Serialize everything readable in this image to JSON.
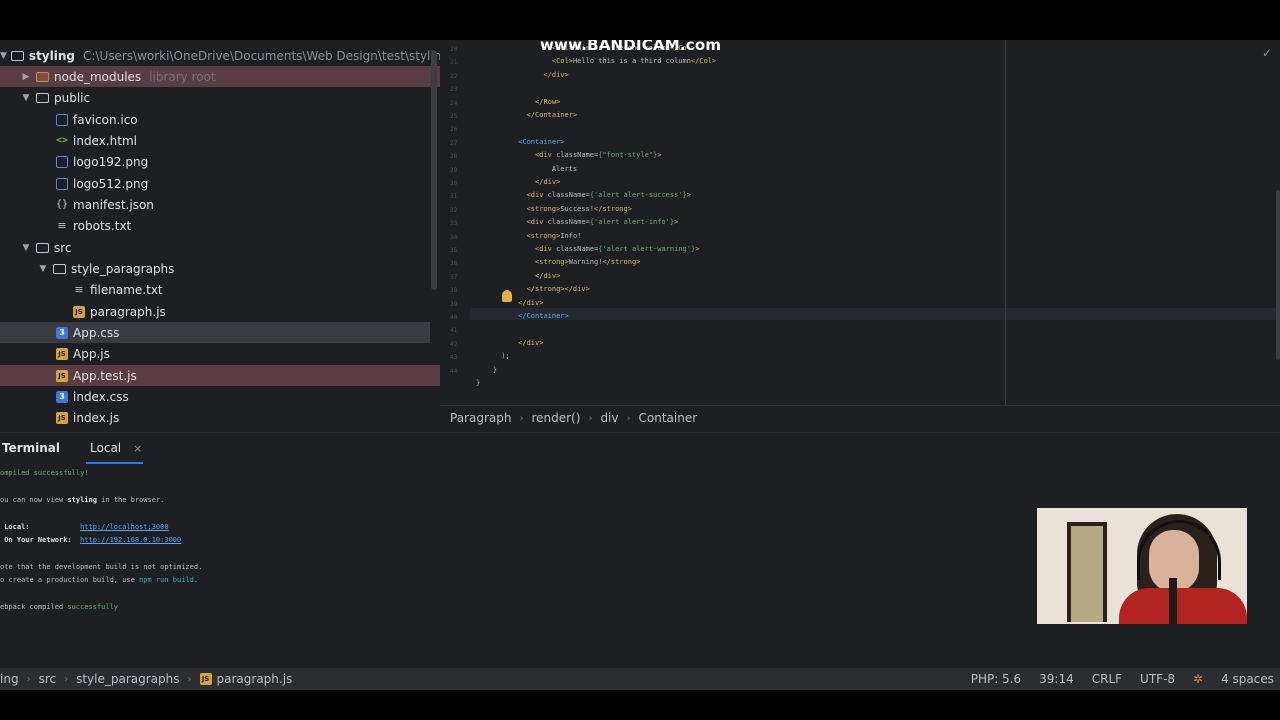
{
  "watermark": "www.BANDICAM.com",
  "project_tree": {
    "root_name": "styling",
    "root_path": "C:\\Users\\worki\\OneDrive\\Documents\\Web Design\\test\\styling",
    "items": [
      {
        "label": "node_modules",
        "note": "library root"
      },
      {
        "label": "public"
      },
      {
        "label": "favicon.ico"
      },
      {
        "label": "index.html"
      },
      {
        "label": "logo192.png"
      },
      {
        "label": "logo512.png"
      },
      {
        "label": "manifest.json"
      },
      {
        "label": "robots.txt"
      },
      {
        "label": "src"
      },
      {
        "label": "style_paragraphs"
      },
      {
        "label": "filename.txt"
      },
      {
        "label": "paragraph.js"
      },
      {
        "label": "App.css"
      },
      {
        "label": "App.js"
      },
      {
        "label": "App.test.js"
      },
      {
        "label": "index.css"
      },
      {
        "label": "index.js"
      }
    ]
  },
  "editor": {
    "line_numbers": [
      "20",
      "21",
      "22",
      "23",
      "24",
      "25",
      "26",
      "27",
      "28",
      "29",
      "30",
      "31",
      "32",
      "33",
      "34",
      "35",
      "36",
      "37",
      "38",
      "39",
      "40",
      "41",
      "42",
      "43",
      "44"
    ],
    "lines": [
      {
        "indent": "                  ",
        "parts": [
          [
            "tag",
            "<Col>"
          ],
          [
            "txt",
            "This is a second column"
          ],
          [
            "tag",
            "</Col>"
          ]
        ]
      },
      {
        "indent": "                  ",
        "parts": [
          [
            "tag",
            "<Col>"
          ],
          [
            "txt",
            "Hello this is a third column"
          ],
          [
            "tag",
            "</Col>"
          ]
        ]
      },
      {
        "indent": "                ",
        "parts": [
          [
            "tag",
            "</div>"
          ]
        ]
      },
      {
        "indent": "",
        "parts": []
      },
      {
        "indent": "              ",
        "parts": [
          [
            "tag",
            "</Row>"
          ]
        ]
      },
      {
        "indent": "            ",
        "parts": [
          [
            "tag",
            "</Container>"
          ]
        ]
      },
      {
        "indent": "",
        "parts": []
      },
      {
        "indent": "          ",
        "parts": [
          [
            "cmp",
            "<Container>"
          ]
        ]
      },
      {
        "indent": "              ",
        "parts": [
          [
            "tag",
            "<div "
          ],
          [
            "attr",
            "className="
          ],
          [
            "str",
            "{\"font-style\"}"
          ],
          [
            "tag",
            ">"
          ]
        ]
      },
      {
        "indent": "                  ",
        "parts": [
          [
            "txt",
            "Alerts"
          ]
        ]
      },
      {
        "indent": "              ",
        "parts": [
          [
            "tag",
            "</div>"
          ]
        ]
      },
      {
        "indent": "            ",
        "parts": [
          [
            "tag",
            "<div "
          ],
          [
            "attr",
            "className="
          ],
          [
            "str",
            "{'alert alert-success'}"
          ],
          [
            "tag",
            ">"
          ]
        ]
      },
      {
        "indent": "            ",
        "parts": [
          [
            "tag",
            "<strong>"
          ],
          [
            "txt",
            "Success!"
          ],
          [
            "tag",
            "</strong>"
          ]
        ]
      },
      {
        "indent": "            ",
        "parts": [
          [
            "tag",
            "<div "
          ],
          [
            "attr",
            "className="
          ],
          [
            "str",
            "{'alert alert-info'}"
          ],
          [
            "tag",
            ">"
          ]
        ]
      },
      {
        "indent": "            ",
        "parts": [
          [
            "tag",
            "<strong>"
          ],
          [
            "txt",
            "Info!"
          ]
        ]
      },
      {
        "indent": "              ",
        "parts": [
          [
            "tag",
            "<div "
          ],
          [
            "attr",
            "className="
          ],
          [
            "str",
            "{'alert alert-warning'}"
          ],
          [
            "tag",
            ">"
          ]
        ]
      },
      {
        "indent": "              ",
        "parts": [
          [
            "tag",
            "<strong>"
          ],
          [
            "txt",
            "Warning!"
          ],
          [
            "tag",
            "</strong>"
          ]
        ]
      },
      {
        "indent": "              ",
        "parts": [
          [
            "tag",
            "</div>"
          ]
        ]
      },
      {
        "indent": "            ",
        "parts": [
          [
            "tag",
            "</strong></div>"
          ]
        ]
      },
      {
        "indent": "          ",
        "parts": [
          [
            "tag",
            "</div>"
          ]
        ]
      },
      {
        "indent": "          ",
        "parts": [
          [
            "cmp",
            "</Container>"
          ]
        ]
      },
      {
        "indent": "",
        "parts": []
      },
      {
        "indent": "          ",
        "parts": [
          [
            "tag",
            "</div>"
          ]
        ]
      },
      {
        "indent": "      ",
        "parts": [
          [
            "txt",
            ");"
          ]
        ]
      },
      {
        "indent": "    ",
        "parts": [
          [
            "txt",
            "}"
          ]
        ]
      },
      {
        "indent": "",
        "parts": [
          [
            "txt",
            "}"
          ]
        ]
      }
    ]
  },
  "breadcrumb": [
    "Paragraph",
    "render()",
    "div",
    "Container"
  ],
  "terminal": {
    "title": "Terminal",
    "tab_label": "Local",
    "close_glyph": "×",
    "lines": {
      "compiled": "ompiled successfully!",
      "view_pre": "ou can now view ",
      "view_app": "styling",
      "view_post": " in the browser.",
      "local_label": " Local:            ",
      "local_url": "http://localhost:3000",
      "network_label": " On Your Network:  ",
      "network_url": "http://192.168.0.10:3000",
      "note1": "ote that the development build is not optimized.",
      "note2_pre": "o create a production build, use ",
      "note2_cmd": "npm run build",
      "note2_post": ".",
      "webpack_pre": "ebpack compiled ",
      "webpack_ok": "successfully"
    }
  },
  "statusbar": {
    "path": [
      "ing",
      "src",
      "style_paragraphs",
      "paragraph.js"
    ],
    "php": "PHP: 5.6",
    "cursor": "39:14",
    "line_sep": "CRLF",
    "encoding": "UTF-8",
    "indent": "4 spaces"
  }
}
